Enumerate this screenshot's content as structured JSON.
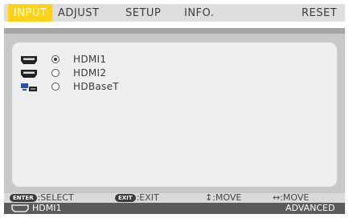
{
  "tabs": [
    "INPUT",
    "ADJUST",
    "SETUP",
    "INFO.",
    "RESET"
  ],
  "inputs": [
    {
      "icon": "hdmi-connector-icon",
      "label": "HDMI1",
      "selected": true
    },
    {
      "icon": "hdmi-connector-icon",
      "label": "HDMI2",
      "selected": false
    },
    {
      "icon": "network-connector-icon",
      "label": "HDBaseT",
      "selected": false
    }
  ],
  "help": {
    "enter_key": "ENTER",
    "select": ":SELECT",
    "exit_key": "EXIT",
    "exit": ":EXIT",
    "move_vertical": "↕:MOVE",
    "move_horizontal": "↔:MOVE"
  },
  "status": {
    "current_input": "HDMI1",
    "mode": "ADVANCED"
  },
  "colors": {
    "active_tab": "#ffd21a",
    "menu_background": "#c8c8c8",
    "status_bar": "#5a5a5a"
  }
}
